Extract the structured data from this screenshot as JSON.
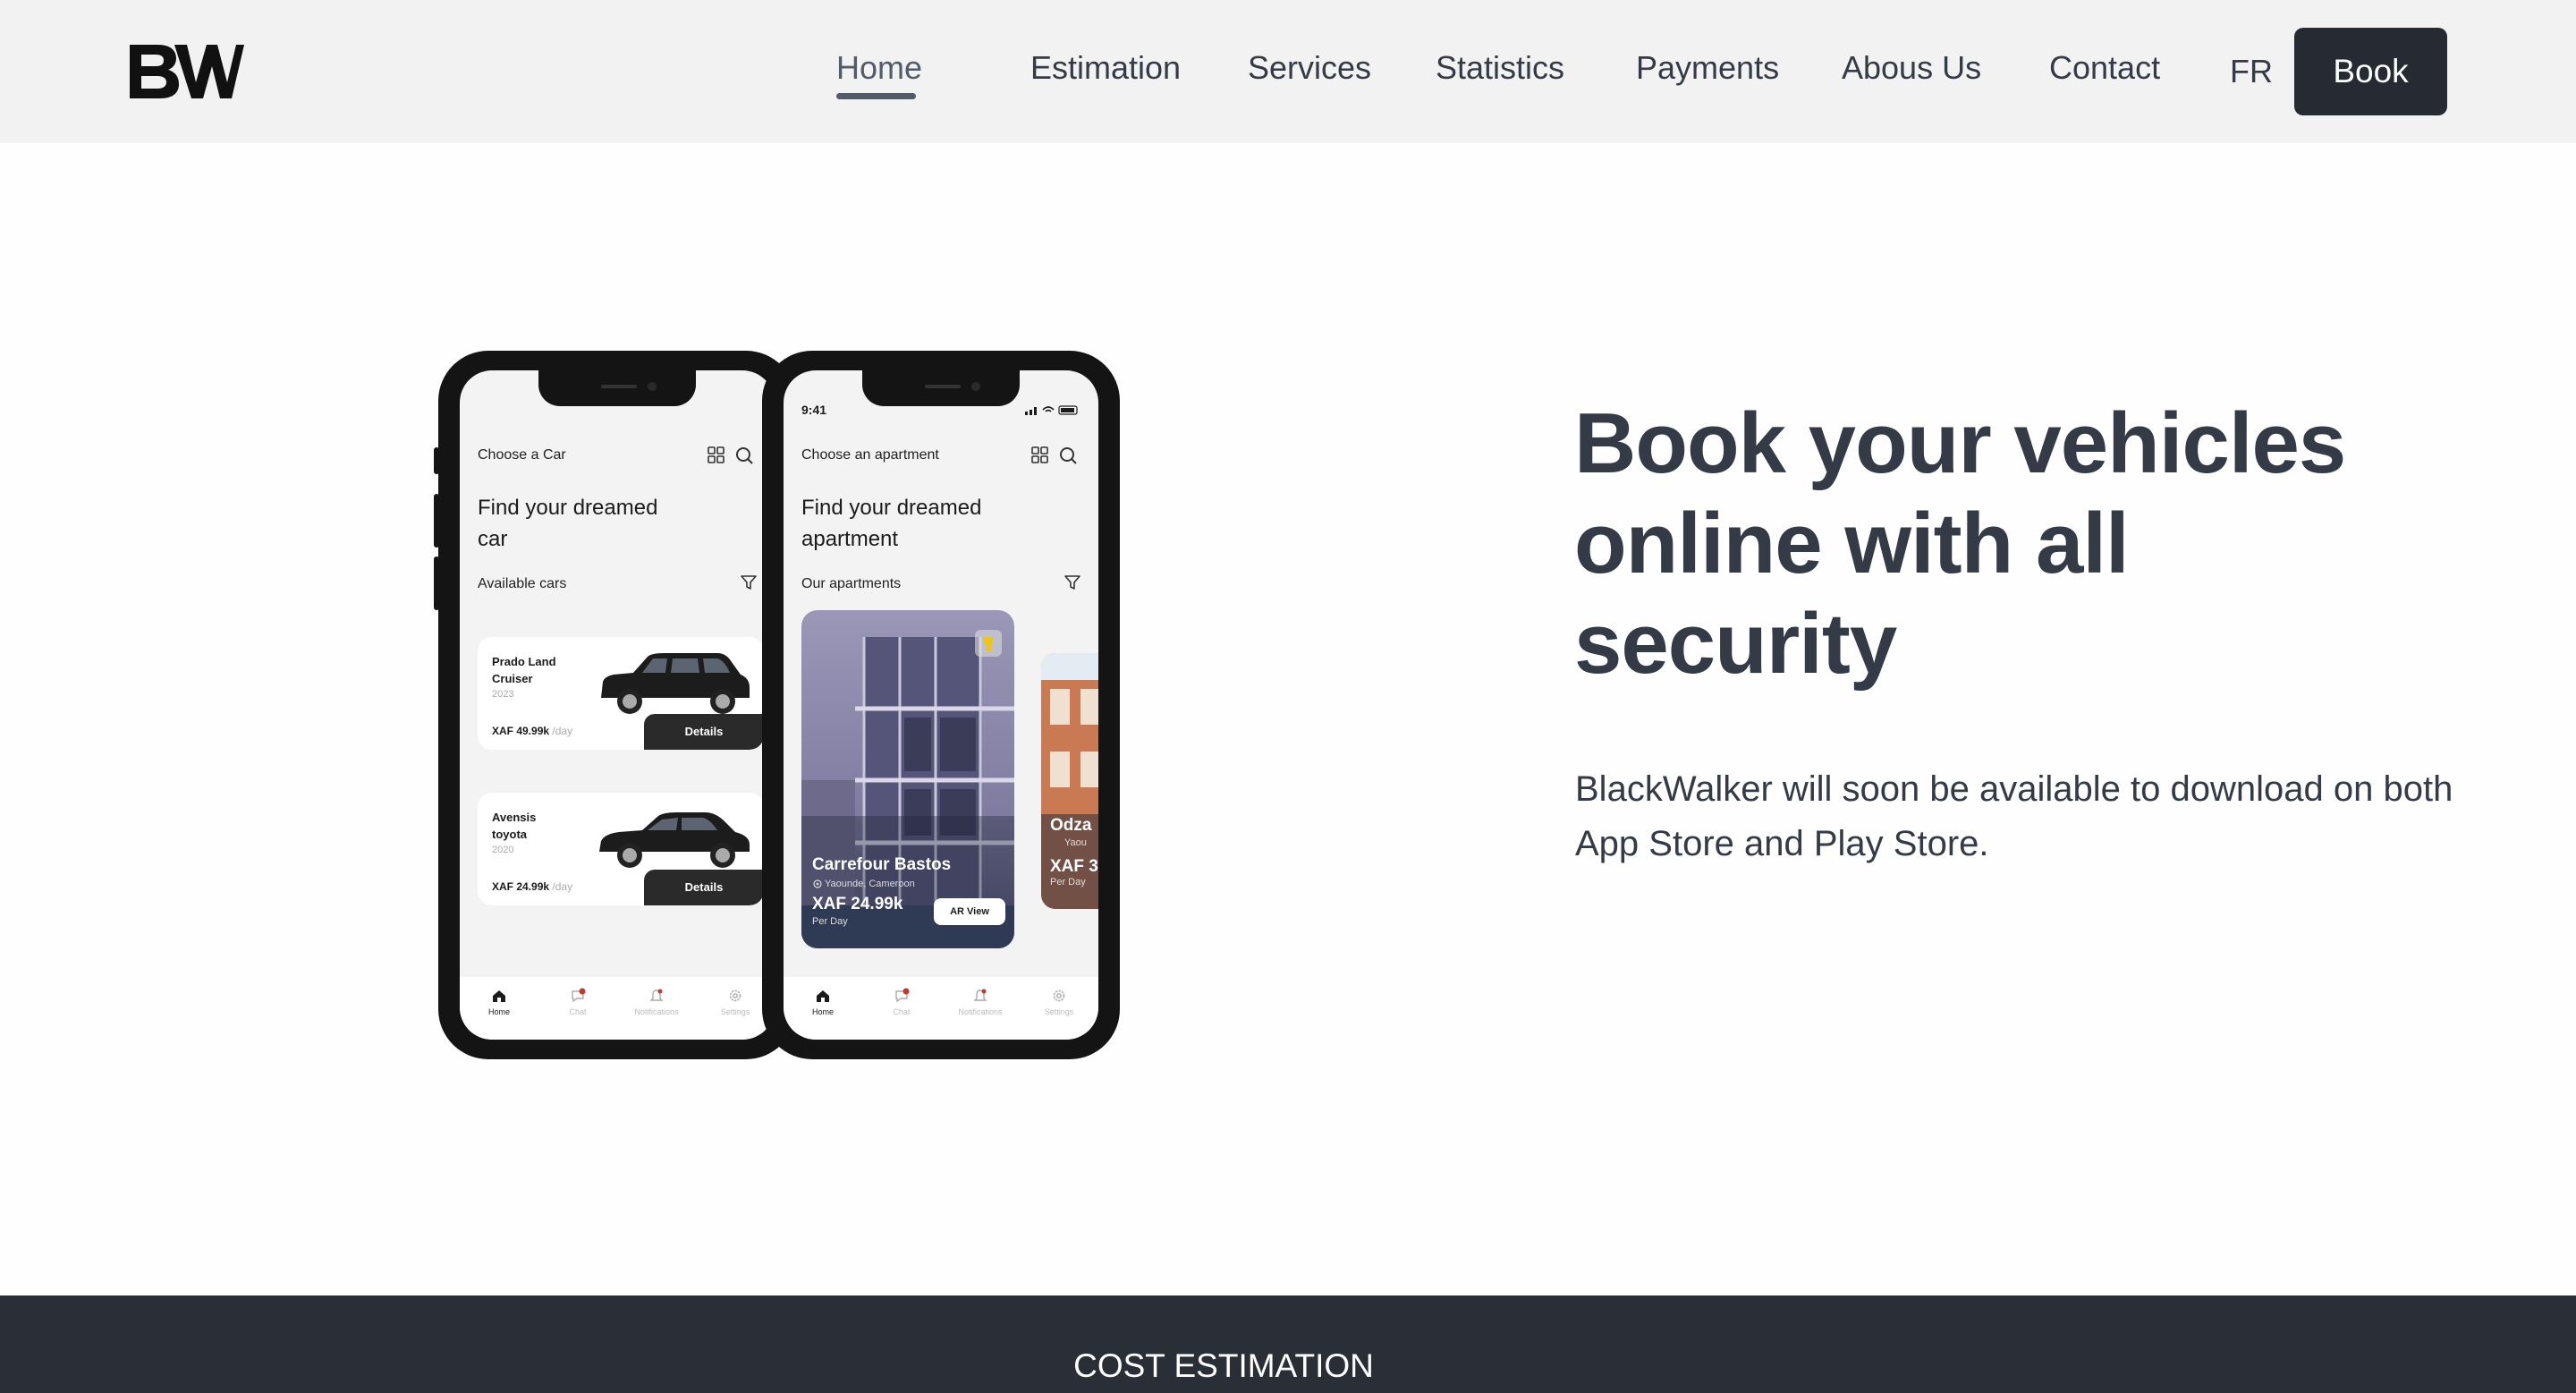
{
  "header": {
    "logo_text": "BW",
    "nav": [
      {
        "label": "Home",
        "active": true
      },
      {
        "label": "Estimation"
      },
      {
        "label": "Services"
      },
      {
        "label": "Statistics"
      },
      {
        "label": "Payments"
      },
      {
        "label": "Abous Us"
      },
      {
        "label": "Contact"
      }
    ],
    "lang": "FR",
    "book_label": "Book",
    "colors": {
      "header_bg": "#f2f2f2",
      "book_bg": "#262a33",
      "active_underline": "#545b68"
    }
  },
  "hero": {
    "title_lines": [
      "Book your vehicles",
      "online with all",
      "security"
    ],
    "subtitle_lines": [
      "BlackWalker will soon be available to download on both",
      "App Store and Play Store."
    ]
  },
  "phone_left": {
    "title": "Choose a Car",
    "heading_lines": [
      "Find your dreamed",
      "car"
    ],
    "section": "Available cars",
    "cars": [
      {
        "name_lines": [
          "Prado Land",
          "Cruiser"
        ],
        "year": "2023",
        "price": "XAF 49.99k",
        "unit": "/day",
        "button": "Details"
      },
      {
        "name_lines": [
          "Avensis",
          "toyota"
        ],
        "year": "2020",
        "price": "XAF 24.99k",
        "unit": "/day",
        "button": "Details"
      }
    ],
    "tabs": [
      "Home",
      "Chat",
      "Notifications",
      "Settings"
    ]
  },
  "phone_right": {
    "time": "9:41",
    "title": "Choose an apartment",
    "heading_lines": [
      "Find your dreamed",
      "apartment"
    ],
    "section": "Our apartments",
    "apartments": [
      {
        "name": "Carrefour Bastos",
        "location": "Yaounde, Cameroon",
        "price": "XAF 24.99k",
        "per": "Per Day",
        "button": "AR View"
      },
      {
        "name": "Odza",
        "location": "Yaou",
        "price": "XAF 3",
        "per": "Per Day"
      }
    ],
    "tabs": [
      "Home",
      "Chat",
      "Notifications",
      "Settings"
    ]
  },
  "band": {
    "title": "COST ESTIMATION",
    "bg_color": "#2a2e37"
  },
  "icons": [
    "bw-logo-icon",
    "grid-icon",
    "search-icon",
    "filter-icon",
    "home-icon",
    "chat-icon",
    "bell-icon",
    "gear-icon",
    "location-pin-icon",
    "trophy-icon"
  ]
}
